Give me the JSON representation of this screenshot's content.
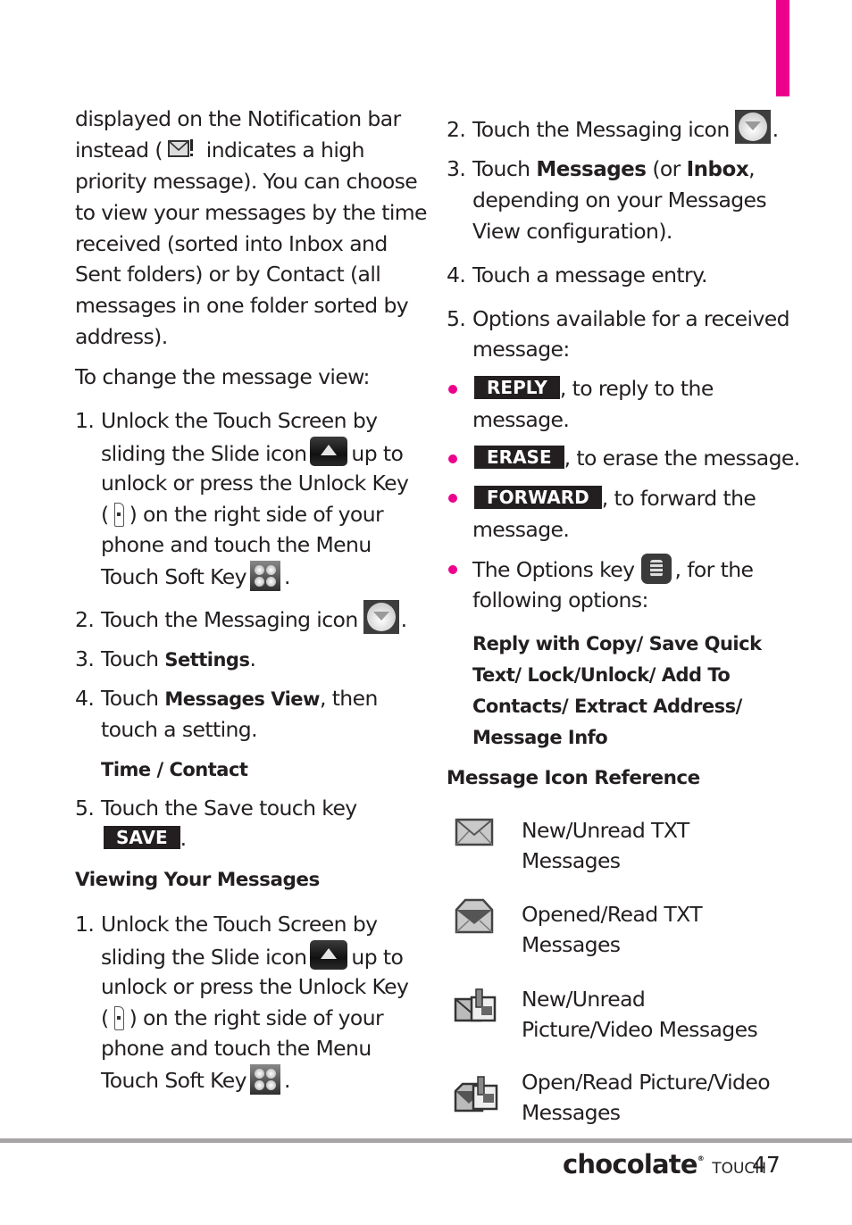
{
  "page": {
    "accent_color": "#ec008c",
    "rule_color": "#a7a5a5",
    "page_number": "47",
    "brand": {
      "name": "chocolate",
      "suffix": "TOUCH",
      "mark": "®"
    }
  },
  "left": {
    "intro_lines": [
      "displayed on the Notification bar",
      "instead (",
      " indicates a high",
      "priority message). You can choose",
      "to view your messages by the time",
      "received (sorted into Inbox and",
      "Sent folders) or by Contact (all",
      "messages in one folder sorted by",
      "address)."
    ],
    "change_view_heading": "To change the message view:",
    "steps": {
      "s1": {
        "num": "1.",
        "l1": "Unlock the Touch Screen by",
        "l2a": "sliding the Slide icon",
        "l2b": "up to",
        "l3": "unlock or press the Unlock Key",
        "l4a": "(",
        "l4b": ") on the right side of your",
        "l5": "phone and touch the Menu",
        "l6a": "Touch Soft Key",
        "l6b": "."
      },
      "s2": {
        "num": "2.",
        "text": "Touch the Messaging icon",
        "end": "."
      },
      "s3": {
        "num": "3.",
        "text": "Touch ",
        "bold": "Settings",
        "end": "."
      },
      "s4": {
        "num": "4.",
        "text": "Touch ",
        "bold": "Messages View",
        "rest": ", then",
        "l2": "touch a setting."
      },
      "s4_options": "Time / Contact",
      "s5": {
        "num": "5.",
        "text": "Touch the Save touch key",
        "key": "SAVE",
        "end": "."
      }
    },
    "viewing_heading": "Viewing Your Messages",
    "viewing_step1": {
      "num": "1.",
      "l1": "Unlock the Touch Screen by",
      "l2a": "sliding the Slide icon",
      "l2b": "up to",
      "l3": "unlock or press the Unlock Key",
      "l4a": "(",
      "l4b": ") on the right side of your",
      "l5": "phone and touch the Menu",
      "l6a": "Touch Soft Key",
      "l6b": "."
    }
  },
  "right": {
    "s2": {
      "num": "2.",
      "text": "Touch the Messaging icon",
      "end": "."
    },
    "s3": {
      "num": "3.",
      "text": "Touch ",
      "bold1": "Messages",
      "mid": " (or ",
      "bold2": "Inbox",
      "end": ",",
      "l2": "depending on your Messages",
      "l3": "View configuration)."
    },
    "s4": {
      "num": "4.",
      "text": "Touch a message entry."
    },
    "s5": {
      "num": "5.",
      "l1": "Options available for a received",
      "l2": "message:"
    },
    "bullets": {
      "reply": {
        "key": "REPLY",
        "text": ", to reply to the",
        "l2": "message."
      },
      "erase": {
        "key": "ERASE",
        "text": ", to erase the message."
      },
      "forward": {
        "key": "FORWARD",
        "text": ", to forward the",
        "l2": "message."
      },
      "options": {
        "text": "The Options key",
        "rest": ", for the",
        "l2": "following options:"
      }
    },
    "options_list": [
      "Reply with Copy/ Save Quick",
      "Text/ Lock/Unlock/ Add To",
      "Contacts/ Extract Address/",
      "Message Info"
    ],
    "icon_ref_heading": "Message Icon Reference",
    "icon_refs": [
      {
        "icon": "envelope-closed-icon",
        "l1": "New/Unread TXT",
        "l2": "Messages"
      },
      {
        "icon": "envelope-open-icon",
        "l1": "Opened/Read TXT",
        "l2": "Messages"
      },
      {
        "icon": "picture-envelope-closed-icon",
        "l1": "New/Unread",
        "l2": "Picture/Video Messages"
      },
      {
        "icon": "picture-envelope-open-icon",
        "l1": "Open/Read Picture/Video",
        "l2": "Messages"
      }
    ]
  }
}
